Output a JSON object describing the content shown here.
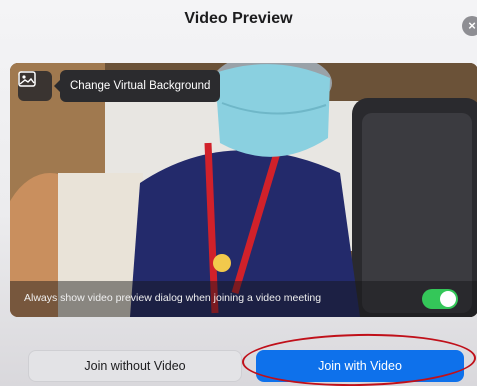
{
  "dialog": {
    "title": "Video Preview",
    "close_glyph": "×"
  },
  "preview": {
    "virtual_background_icon": "image-icon",
    "virtual_background_tooltip": "Change Virtual Background",
    "always_show_label": "Always show video preview dialog when joining a video meeting",
    "always_show_enabled": true,
    "toggle_color": "#34c759"
  },
  "buttons": {
    "join_without_video": "Join without Video",
    "join_with_video": "Join with Video",
    "primary_color": "#0e71eb"
  },
  "annotation": {
    "color": "#c0101a"
  }
}
